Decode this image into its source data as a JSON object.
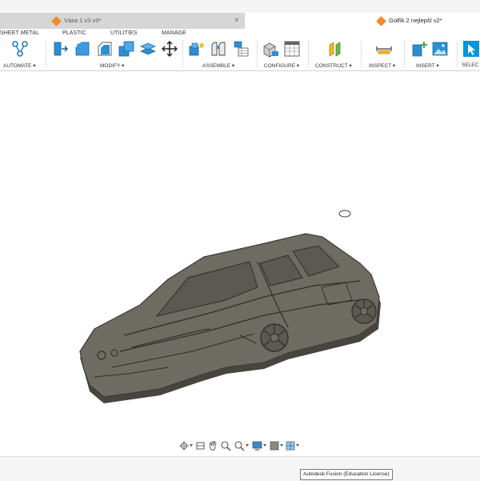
{
  "tabs": [
    {
      "title": "Váza 1 v3 v3*",
      "close": "×"
    },
    {
      "title": "Golfík 2 nejlepší v2*"
    }
  ],
  "menu": {
    "sheet_metal": "SHEET METAL",
    "plastic": "PLASTIC",
    "utilities": "UTILITIES",
    "manage": "MANAGE"
  },
  "groups": {
    "automate": "AUTOMATE ▾",
    "modify": "MODIFY ▾",
    "assemble": "ASSEMBLE ▾",
    "configure": "CONFIGURE ▾",
    "construct": "CONSTRUCT ▾",
    "inspect": "INSPECT ▾",
    "insert": "INSERT ▾",
    "select": "SELEC"
  },
  "nav_icons": [
    "orbit-icon",
    "look-at-icon",
    "pan-icon",
    "zoom-icon",
    "fit-icon",
    "display-settings-icon",
    "visual-style-icon",
    "grid-icon"
  ],
  "status": {
    "license_tooltip": "Autodesk Fusion (Education License)"
  },
  "colors": {
    "accent": "#0696d7",
    "model_top": "#6e6c62",
    "model_edge": "#47453e",
    "tab_icon": "#f08c2a"
  }
}
